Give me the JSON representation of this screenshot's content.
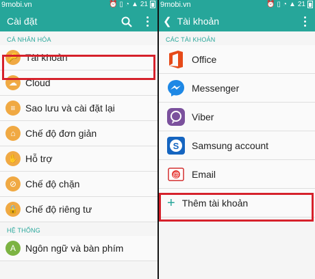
{
  "watermark": "9mobi.vn",
  "status": {
    "battery_text": "21"
  },
  "left": {
    "title": "Cài đặt",
    "section_personal": "CÁ NHÂN HÓA",
    "section_system": "HỆ THỐNG",
    "items": [
      {
        "label": "Tài khoản",
        "icon": "key-icon"
      },
      {
        "label": "Cloud",
        "icon": "cloud-icon"
      },
      {
        "label": "Sao lưu và cài đặt lại",
        "icon": "backup-icon"
      },
      {
        "label": "Chế độ đơn giản",
        "icon": "home-icon"
      },
      {
        "label": "Hỗ trợ",
        "icon": "hand-icon"
      },
      {
        "label": "Chế độ chặn",
        "icon": "block-icon"
      },
      {
        "label": "Chế độ riêng tư",
        "icon": "lock-icon"
      }
    ],
    "system_items": [
      {
        "label": "Ngôn ngữ và bàn phím",
        "icon": "language-icon"
      }
    ]
  },
  "right": {
    "title": "Tài khoản",
    "section_accounts": "CÁC TÀI KHOẢN",
    "accounts": [
      {
        "label": "Office",
        "icon": "office-icon"
      },
      {
        "label": "Messenger",
        "icon": "messenger-icon"
      },
      {
        "label": "Viber",
        "icon": "viber-icon"
      },
      {
        "label": "Samsung account",
        "icon": "samsung-account-icon"
      },
      {
        "label": "Email",
        "icon": "email-icon"
      }
    ],
    "add_account": "Thêm tài khoản"
  },
  "colors": {
    "accent": "#26a69a",
    "highlight": "#d6212b"
  }
}
